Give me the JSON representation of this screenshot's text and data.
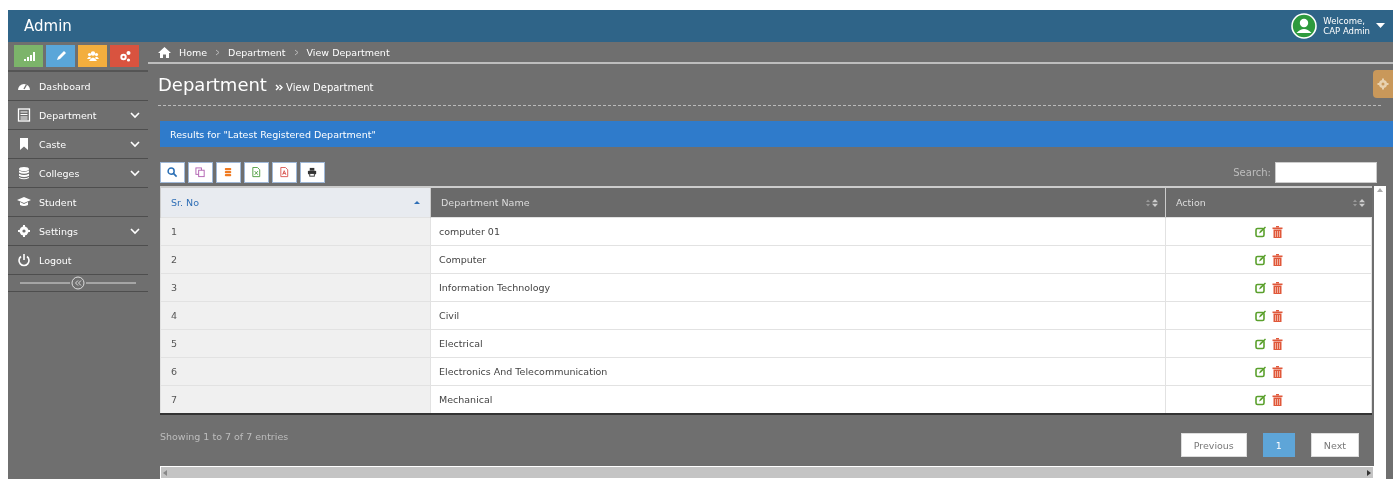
{
  "header": {
    "title": "Admin",
    "welcome": "Welcome,",
    "user": "CAP Admin"
  },
  "shortcuts": [
    {
      "color": "#7cb46a"
    },
    {
      "color": "#5aa6d9"
    },
    {
      "color": "#f3ae3e"
    },
    {
      "color": "#d9533f"
    }
  ],
  "breadcrumb": [
    "Home",
    "Department",
    "View Department"
  ],
  "sidebar": {
    "items": [
      {
        "label": "Dashboard",
        "expandable": false
      },
      {
        "label": "Department",
        "expandable": true
      },
      {
        "label": "Caste",
        "expandable": true
      },
      {
        "label": "Colleges",
        "expandable": true
      },
      {
        "label": "Student",
        "expandable": false
      },
      {
        "label": "Settings",
        "expandable": true
      },
      {
        "label": "Logout",
        "expandable": false
      }
    ]
  },
  "page": {
    "title": "Department",
    "subtitle": "View Department"
  },
  "banner": "Results for \"Latest Registered Department\"",
  "search_label": "Search:",
  "table": {
    "columns": [
      {
        "label": "Sr. No",
        "sorted": true
      },
      {
        "label": "Department Name",
        "sorted": false
      },
      {
        "label": "Action",
        "sorted": false
      }
    ],
    "rows": [
      [
        "1",
        "computer 01"
      ],
      [
        "2",
        "Computer"
      ],
      [
        "3",
        "Information Technology"
      ],
      [
        "4",
        "Civil"
      ],
      [
        "5",
        "Electrical"
      ],
      [
        "6",
        "Electronics And Telecommunication"
      ],
      [
        "7",
        "Mechanical"
      ]
    ]
  },
  "info": "Showing 1 to 7 of 7 entries",
  "pagination": {
    "previous": "Previous",
    "pages": [
      {
        "label": "1",
        "selected": true
      }
    ],
    "next": "Next"
  }
}
